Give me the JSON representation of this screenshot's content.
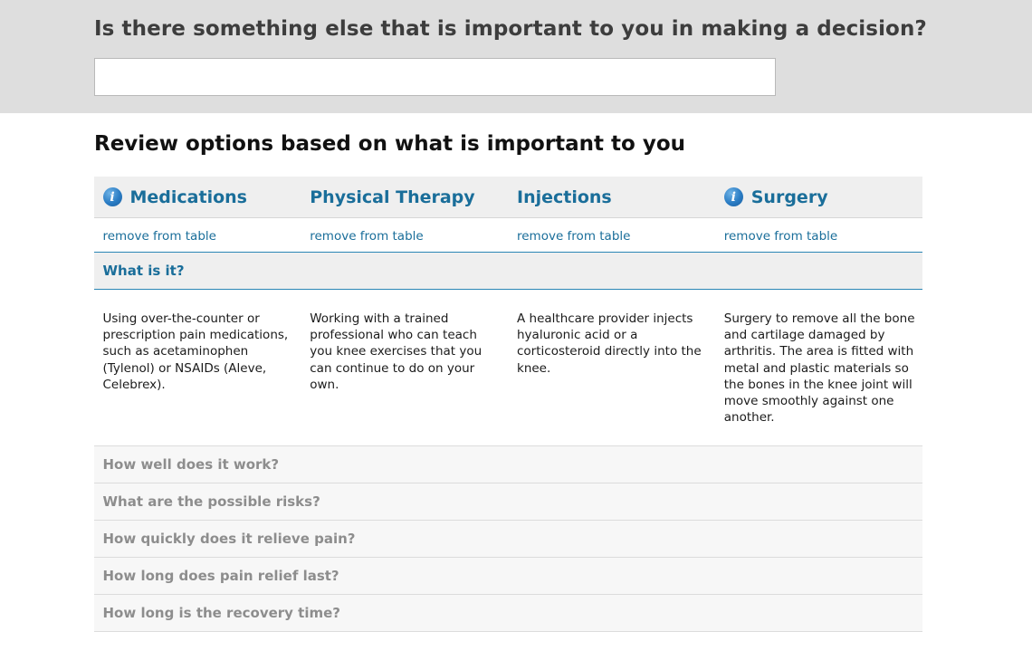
{
  "decision": {
    "question": "Is there something else that is important to you in making a decision?",
    "answer_value": ""
  },
  "review": {
    "title": "Review options based on what is important to you",
    "options": [
      {
        "name": "Medications",
        "has_info_icon": true,
        "remove_label": "remove from table",
        "description": "Using over-the-counter or prescription pain medications, such as acetaminophen (Tylenol) or NSAIDs (Aleve, Celebrex)."
      },
      {
        "name": "Physical Therapy",
        "has_info_icon": false,
        "remove_label": "remove from table",
        "description": "Working with a trained professional who can teach you knee exercises that you can continue to do on your own."
      },
      {
        "name": "Injections",
        "has_info_icon": false,
        "remove_label": "remove from table",
        "description": "A healthcare provider injects hyaluronic acid or a corticosteroid directly into the knee."
      },
      {
        "name": "Surgery",
        "has_info_icon": true,
        "remove_label": "remove from table",
        "description": "Surgery to remove all the bone and cartilage damaged by arthritis. The area is fitted with metal and plastic materials so the bones in the knee joint will move smoothly against one another."
      }
    ],
    "open_section": "What is it?",
    "collapsed_sections": [
      "How well does it work?",
      "What are the possible risks?",
      "How quickly does it relieve pain?",
      "How long does pain relief last?",
      "How long is the recovery time?"
    ]
  },
  "icons": {
    "info": "info-icon",
    "info_glyph": "i"
  },
  "colors": {
    "top_band": "#dedede",
    "link_blue": "#1a6e9a",
    "accent_border": "#2a86b5",
    "collapsed_text": "#8d8d8d",
    "header_bg": "#efefef"
  }
}
